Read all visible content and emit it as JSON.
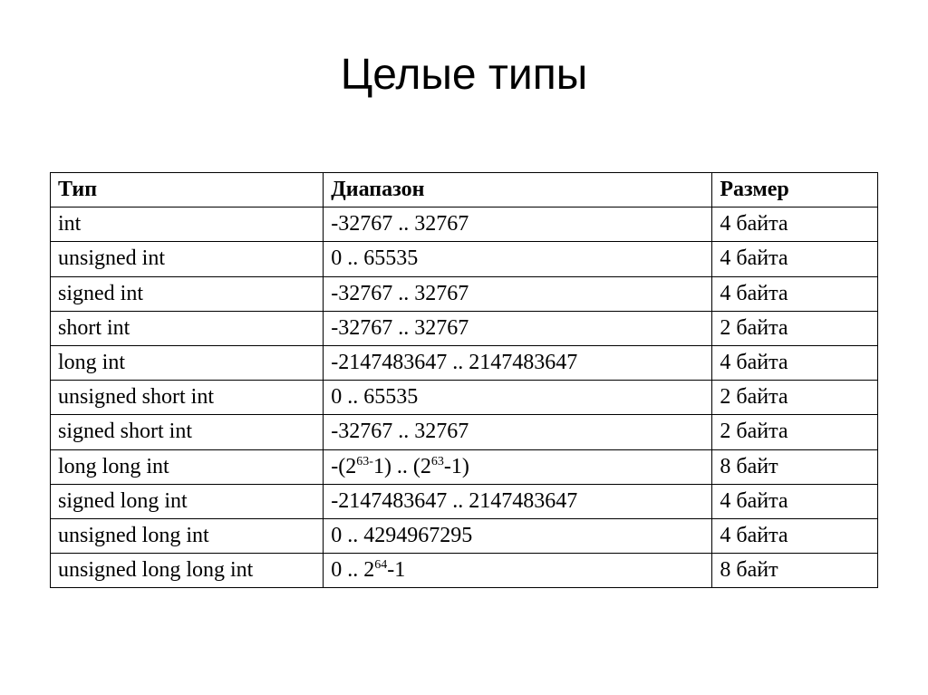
{
  "title": "Целые типы",
  "headers": {
    "type": "Тип",
    "range": "Диапазон",
    "size": "Размер"
  },
  "rows": [
    {
      "type": "int",
      "range": "-32767 .. 32767",
      "size": "4 байта"
    },
    {
      "type": "unsigned int",
      "range": "0 .. 65535",
      "size": "4 байта"
    },
    {
      "type": "signed int",
      "range": "-32767 .. 32767",
      "size": "4 байта"
    },
    {
      "type": "short int",
      "range": "-32767 .. 32767",
      "size": "2 байта"
    },
    {
      "type": "long int",
      "range": "-2147483647 .. 2147483647",
      "size": "4 байта"
    },
    {
      "type": "unsigned short int",
      "range": "0 .. 65535",
      "size": "2 байта"
    },
    {
      "type": "signed short int",
      "range": "-32767 .. 32767",
      "size": "2 байта"
    },
    {
      "type": "long long int",
      "range_html": "-(2<sup>63-</sup>1) .. (2<sup>63</sup>-1)",
      "size": "8 байт"
    },
    {
      "type": "signed long int",
      "range": "-2147483647 .. 2147483647",
      "size": "4 байта"
    },
    {
      "type": "unsigned long int",
      "range": "0 .. 4294967295",
      "size": "4 байта"
    },
    {
      "type": "unsigned long long int",
      "range_html": "0 .. 2<sup>64</sup>-1",
      "size": "8 байт"
    }
  ]
}
